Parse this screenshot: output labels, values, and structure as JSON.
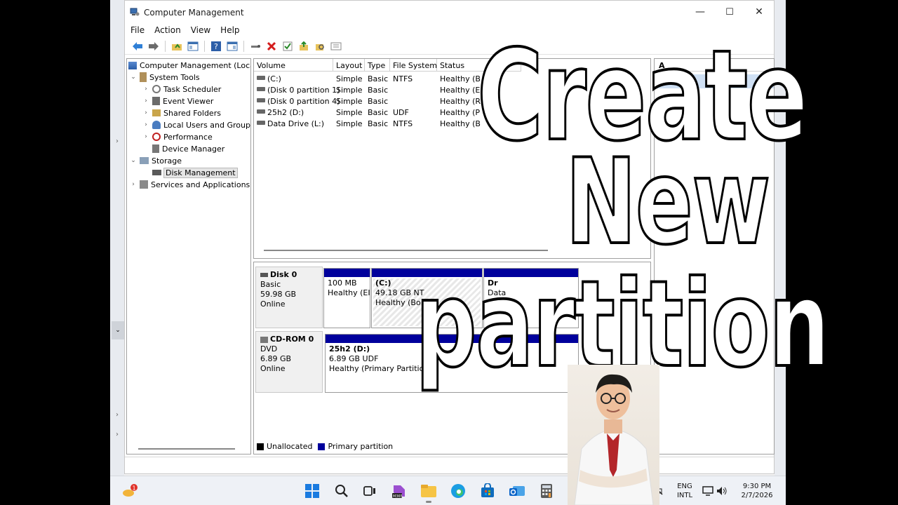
{
  "window": {
    "title": "Computer Management",
    "minimize": "—",
    "maximize": "☐",
    "close": "✕"
  },
  "menu": [
    "File",
    "Action",
    "View",
    "Help"
  ],
  "tree": {
    "root": "Computer Management (Local",
    "system_tools": "System Tools",
    "task_scheduler": "Task Scheduler",
    "event_viewer": "Event Viewer",
    "shared_folders": "Shared Folders",
    "local_users": "Local Users and Groups",
    "performance": "Performance",
    "device_manager": "Device Manager",
    "storage": "Storage",
    "disk_management": "Disk Management",
    "services": "Services and Applications"
  },
  "volume_table": {
    "headers": [
      "Volume",
      "Layout",
      "Type",
      "File System",
      "Status"
    ],
    "rows": [
      {
        "volume": "(C:)",
        "layout": "Simple",
        "type": "Basic",
        "fs": "NTFS",
        "status": "Healthy (B"
      },
      {
        "volume": "(Disk 0 partition 1)",
        "layout": "Simple",
        "type": "Basic",
        "fs": "",
        "status": "Healthy (E"
      },
      {
        "volume": "(Disk 0 partition 4)",
        "layout": "Simple",
        "type": "Basic",
        "fs": "",
        "status": "Healthy (R"
      },
      {
        "volume": "25h2 (D:)",
        "layout": "Simple",
        "type": "Basic",
        "fs": "UDF",
        "status": "Healthy (P"
      },
      {
        "volume": "Data Drive (L:)",
        "layout": "Simple",
        "type": "Basic",
        "fs": "NTFS",
        "status": "Healthy (B"
      }
    ]
  },
  "disks": {
    "disk0": {
      "name": "Disk 0",
      "type": "Basic",
      "size": "59.98 GB",
      "state": "Online"
    },
    "disk0_parts": [
      {
        "line1": "",
        "line2": "100 MB",
        "line3": "Healthy (EI"
      },
      {
        "line1": "(C:)",
        "line2": "49.18 GB NT",
        "line3": "Healthy (Bo"
      },
      {
        "line1": "Dr",
        "line2": "",
        "line3": "Data"
      }
    ],
    "cdrom": {
      "name": "CD-ROM 0",
      "type": "DVD",
      "size": "6.89 GB",
      "state": "Online"
    },
    "cdrom_part": {
      "line1": "25h2  (D:)",
      "line2": "6.89 GB UDF",
      "line3": "Healthy (Primary Partition"
    }
  },
  "legend": {
    "unallocated": "Unallocated",
    "primary": "Primary partition"
  },
  "actions": {
    "header": "A"
  },
  "overlay": {
    "line1": "Create",
    "line2": "New",
    "line3": "partition"
  },
  "taskbar": {
    "notification_count": "1",
    "language": "ENG",
    "layout": "INTL",
    "time": "9:30 PM",
    "date": "2/7/2026",
    "m365_label": "M365"
  },
  "colors": {
    "primary_partition": "#00009c",
    "unallocated": "#000000",
    "accent": "#0a64c8"
  }
}
